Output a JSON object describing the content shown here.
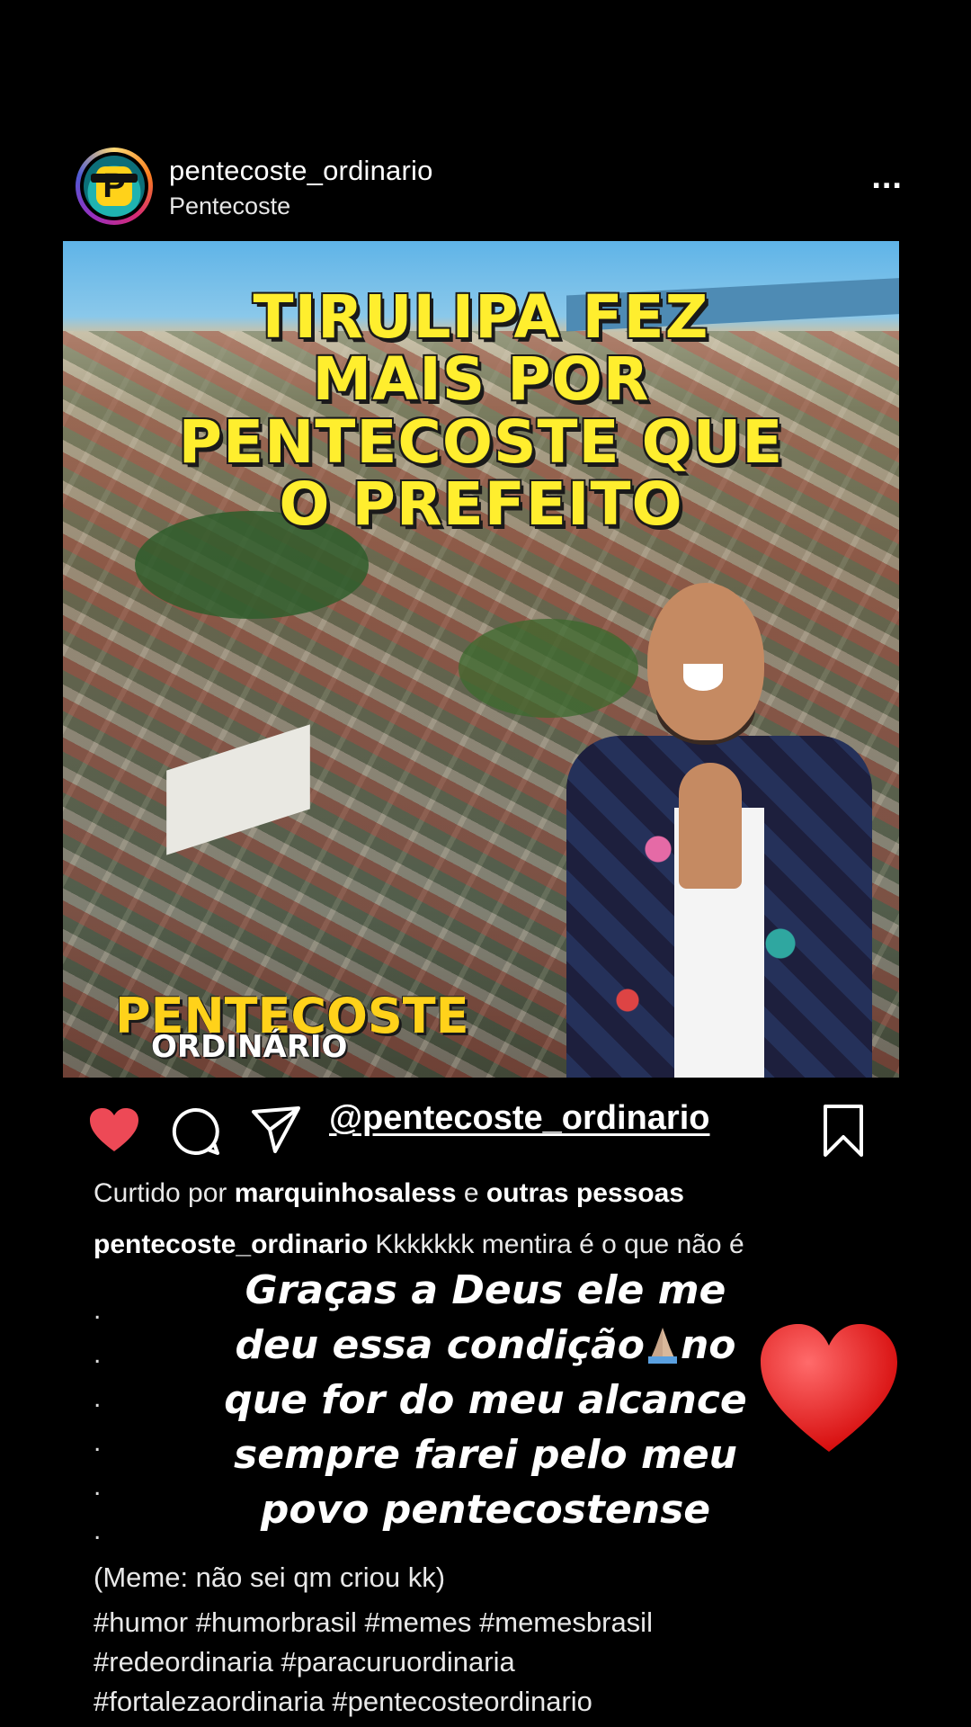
{
  "header": {
    "username": "pentecoste_ordinario",
    "location": "Pentecoste",
    "more": "..."
  },
  "post": {
    "headline": [
      "TIRULIPA FEZ",
      "MAIS POR",
      "PENTECOSTE QUE",
      "O PREFEITO"
    ],
    "brand_top": "PENTECOSTE",
    "brand_bottom": "ORDINÁRIO",
    "avatar_letter": "P"
  },
  "actions": {
    "mention": "@pentecoste_ordinario"
  },
  "likes": {
    "prefix": "Curtido por",
    "user": "marquinhosaless",
    "middle": "e",
    "others": "outras pessoas"
  },
  "caption": {
    "author": "pentecoste_ordinario",
    "text": "Kkkkkkk mentira é o que não é",
    "dots": [
      ".",
      ".",
      ".",
      ".",
      ".",
      "."
    ],
    "meme_note": "(Meme: não sei qm criou kk)",
    "hashtags": [
      "#humor #humorbrasil #memes #memesbrasil",
      "#redeordinaria #paracuruordinaria",
      "#fortalezaordinaria #pentecosteordinario"
    ]
  },
  "overlay": {
    "line1": "Graças a Deus ele me",
    "line2a": "deu essa condição",
    "line2b": "no",
    "line3": "que for do meu alcance",
    "line4": "sempre farei pelo meu",
    "line5": "povo pentecostense"
  },
  "colors": {
    "like_red": "#ed4956",
    "headline_yellow": "#ffee2e",
    "background": "#000000"
  }
}
